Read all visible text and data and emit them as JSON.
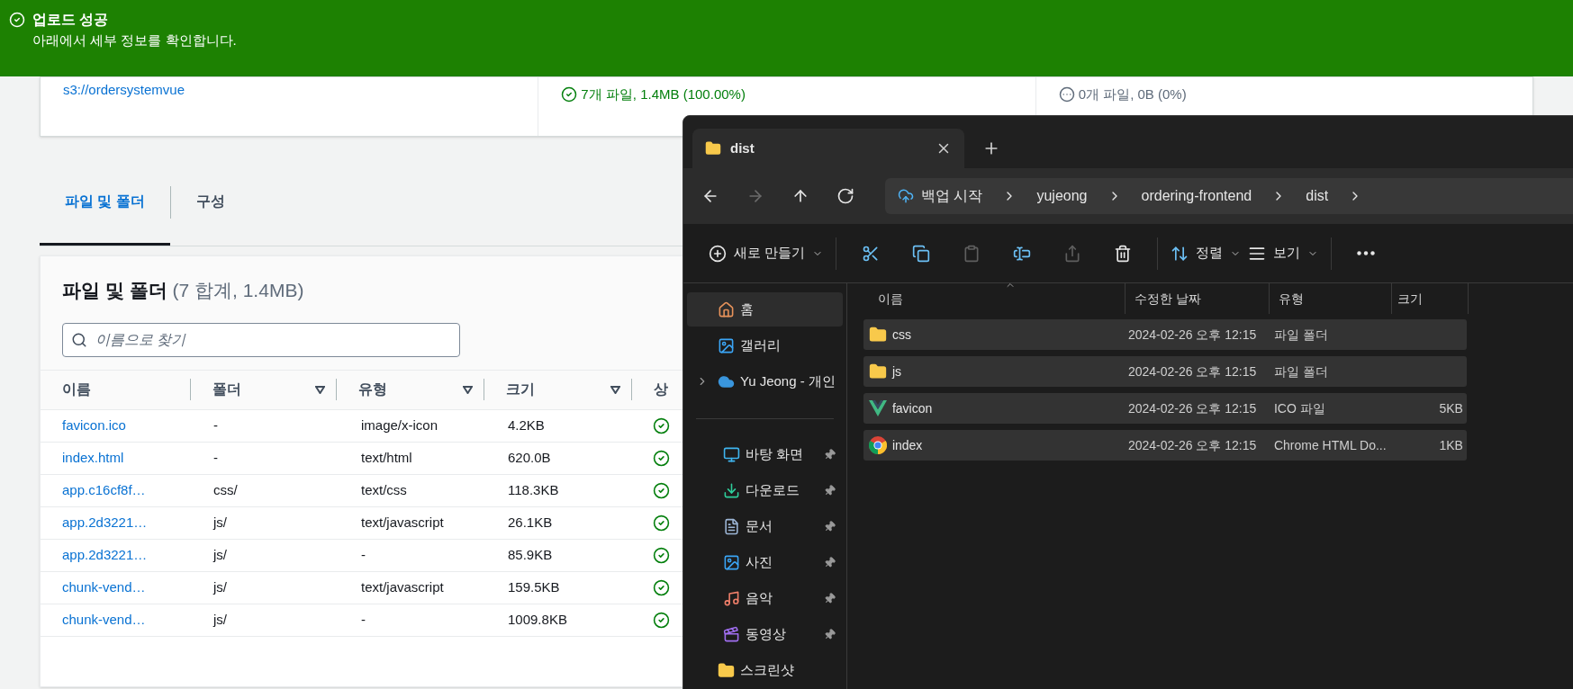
{
  "banner": {
    "title": "업로드 성공",
    "message": "아래에서 세부 정보를 확인합니다."
  },
  "summary": {
    "destination": "s3://ordersystemvue",
    "succeeded": "7개 파일, 1.4MB (100.00%)",
    "failed": "0개 파일, 0B (0%)"
  },
  "tabs": [
    {
      "label": "파일 및 폴더",
      "selected": true
    },
    {
      "label": "구성",
      "selected": false
    }
  ],
  "files_panel": {
    "title": "파일 및 폴더",
    "count": "(7 합계, 1.4MB)",
    "search_placeholder": "이름으로 찾기",
    "columns": [
      {
        "label": "이름",
        "filter": false
      },
      {
        "label": "폴더",
        "filter": true
      },
      {
        "label": "유형",
        "filter": true
      },
      {
        "label": "크기",
        "filter": true
      },
      {
        "label": "상",
        "filter": false
      }
    ],
    "rows": [
      {
        "name": "favicon.ico",
        "folder": "-",
        "type": "image/x-icon",
        "size": "4.2KB",
        "succeeded": true
      },
      {
        "name": "index.html",
        "folder": "-",
        "type": "text/html",
        "size": "620.0B",
        "succeeded": true
      },
      {
        "name": "app.c16cf8f…",
        "folder": "css/",
        "type": "text/css",
        "size": "118.3KB",
        "succeeded": true
      },
      {
        "name": "app.2d3221…",
        "folder": "js/",
        "type": "text/javascript",
        "size": "26.1KB",
        "succeeded": true
      },
      {
        "name": "app.2d3221…",
        "folder": "js/",
        "type": "-",
        "size": "85.9KB",
        "succeeded": true
      },
      {
        "name": "chunk-vend…",
        "folder": "js/",
        "type": "text/javascript",
        "size": "159.5KB",
        "succeeded": true
      },
      {
        "name": "chunk-vend…",
        "folder": "js/",
        "type": "-",
        "size": "1009.8KB",
        "succeeded": true
      }
    ]
  },
  "explorer": {
    "tab_title": "dist",
    "nav": [
      {
        "kind": "back",
        "disabled": false
      },
      {
        "kind": "forward",
        "disabled": true
      },
      {
        "kind": "up",
        "disabled": false
      },
      {
        "kind": "refresh",
        "disabled": false
      }
    ],
    "breadcrumb": [
      "백업 시작",
      "yujeong",
      "ordering-frontend",
      "dist"
    ],
    "toolbar": [
      {
        "kind": "new",
        "label": "새로 만들기",
        "disabled": false
      },
      {
        "kind": "cut",
        "disabled": false
      },
      {
        "kind": "copy",
        "disabled": false
      },
      {
        "kind": "paste",
        "disabled": true
      },
      {
        "kind": "rename",
        "disabled": false
      },
      {
        "kind": "share",
        "disabled": true
      },
      {
        "kind": "delete",
        "disabled": false
      },
      {
        "kind": "sort",
        "label": "정렬",
        "disabled": false
      },
      {
        "kind": "view",
        "label": "보기",
        "disabled": false
      },
      {
        "kind": "more",
        "disabled": false
      }
    ],
    "sidebar": [
      {
        "kind": "home",
        "label": "홈",
        "selected": true,
        "pinned": false,
        "expandable": false
      },
      {
        "kind": "gallery",
        "label": "갤러리",
        "selected": false,
        "pinned": false,
        "expandable": false
      },
      {
        "kind": "cloud",
        "label": "Yu Jeong - 개인",
        "selected": false,
        "pinned": false,
        "expandable": true
      },
      {
        "kind": "divider"
      },
      {
        "kind": "desktop",
        "label": "바탕 화면",
        "selected": false,
        "pinned": true,
        "expandable": false
      },
      {
        "kind": "download",
        "label": "다운로드",
        "selected": false,
        "pinned": true,
        "expandable": false
      },
      {
        "kind": "document",
        "label": "문서",
        "selected": false,
        "pinned": true,
        "expandable": false
      },
      {
        "kind": "pictures",
        "label": "사진",
        "selected": false,
        "pinned": true,
        "expandable": false
      },
      {
        "kind": "music",
        "label": "음악",
        "selected": false,
        "pinned": true,
        "expandable": false
      },
      {
        "kind": "video",
        "label": "동영상",
        "selected": false,
        "pinned": true,
        "expandable": false
      },
      {
        "kind": "folder",
        "label": "스크린샷",
        "selected": false,
        "pinned": false,
        "expandable": false
      }
    ],
    "columns": [
      "이름",
      "수정한 날짜",
      "유형",
      "크기"
    ],
    "rows": [
      {
        "kind": "folder",
        "name": "css",
        "modified": "2024-02-26 오후 12:15",
        "type": "파일 폴더",
        "selected": true
      },
      {
        "kind": "folder",
        "name": "js",
        "modified": "2024-02-26 오후 12:15",
        "type": "파일 폴더",
        "selected": true
      },
      {
        "kind": "vue",
        "name": "favicon",
        "modified": "2024-02-26 오후 12:15",
        "type": "ICO 파일",
        "size": "5KB",
        "selected": true
      },
      {
        "kind": "chrome",
        "name": "index",
        "modified": "2024-02-26 오후 12:15",
        "type": "Chrome HTML Do...",
        "size": "1KB",
        "selected": true
      }
    ]
  }
}
